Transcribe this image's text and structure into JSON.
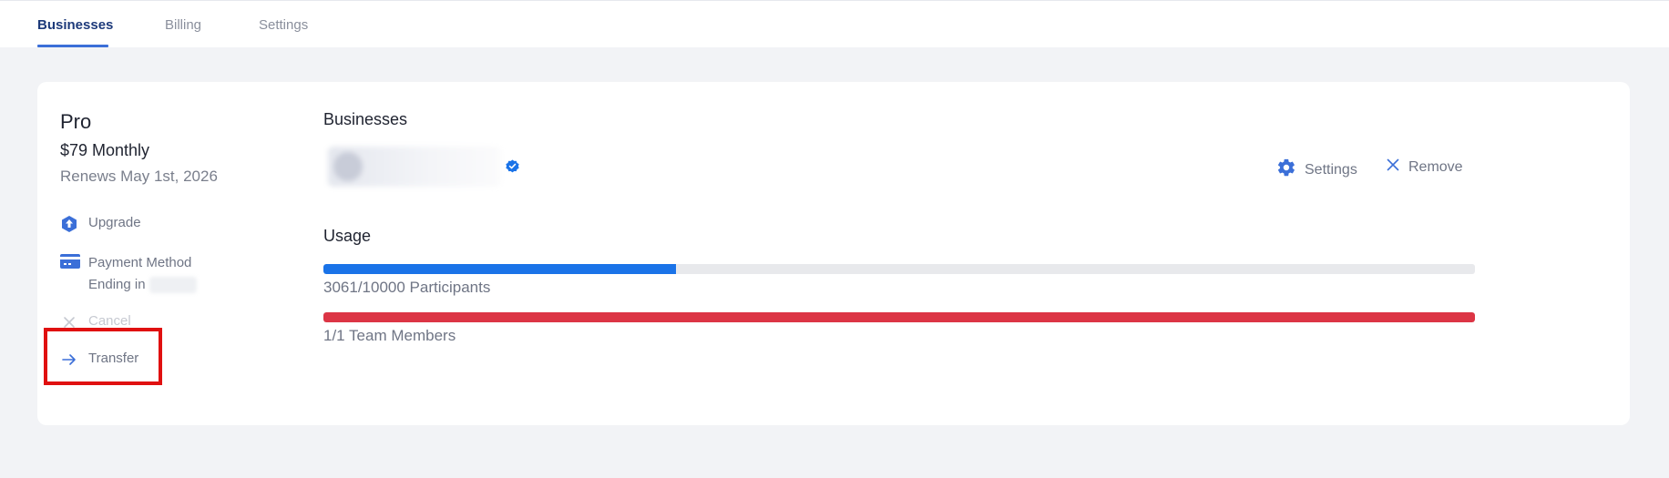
{
  "tabs": [
    {
      "label": "Businesses",
      "active": true
    },
    {
      "label": "Billing",
      "active": false
    },
    {
      "label": "Settings",
      "active": false
    }
  ],
  "plan": {
    "name": "Pro",
    "price": "$79 Monthly",
    "renews": "Renews May 1st, 2026"
  },
  "sidebar": {
    "upgrade": "Upgrade",
    "payment_method": "Payment Method",
    "ending_in": "Ending in",
    "cancel": "Cancel",
    "transfer": "Transfer",
    "icons": [
      "upgrade-icon",
      "credit-card-icon",
      "close-icon",
      "arrow-right-icon"
    ]
  },
  "businesses": {
    "title": "Businesses",
    "settings_label": "Settings",
    "remove_label": "Remove"
  },
  "usage": {
    "title": "Usage",
    "participants": {
      "label": "3061/10000 Participants",
      "used": 3061,
      "total": 10000,
      "color": "#1a73e8"
    },
    "team_members": {
      "label": "1/1 Team Members",
      "used": 1,
      "total": 1,
      "color": "#dc3545"
    }
  },
  "colors": {
    "accent": "#3b6fd8",
    "active_tab": "#1d3a7a",
    "highlight": "#e01010"
  }
}
